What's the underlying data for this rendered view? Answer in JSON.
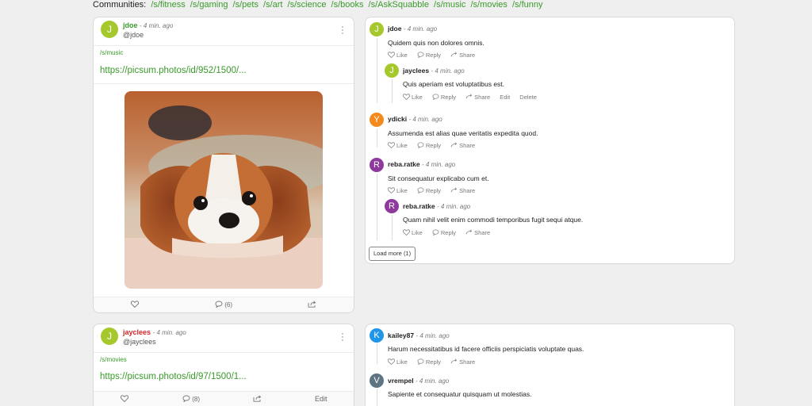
{
  "communities": {
    "label": "Communities:",
    "links": [
      "/s/fitness",
      "/s/gaming",
      "/s/pets",
      "/s/art",
      "/s/science",
      "/s/books",
      "/s/AskSquabble",
      "/s/music",
      "/s/movies",
      "/s/funny"
    ]
  },
  "colors": {
    "accent": "#3a9a2b",
    "avatar_lime": "#a5c92d",
    "avatar_orange": "#f28a1d",
    "avatar_purple": "#8e3a9d",
    "avatar_blue": "#2196e8",
    "avatar_slate": "#5d7482"
  },
  "posts": [
    {
      "avatar_letter": "J",
      "author": "jdoe",
      "time": "- 4 min. ago",
      "handle": "@jdoe",
      "community": "/s/music",
      "link": "https://picsum.photos/id/952/1500/...",
      "comment_count": "(6)",
      "image": "photo of a cavalier king charles spaniel puppy resting on a bed"
    },
    {
      "avatar_letter": "J",
      "author": "jayclees",
      "time": "- 4 min. ago",
      "handle": "@jayclees",
      "community": "/s/movies",
      "link": "https://picsum.photos/id/97/1500/1...",
      "comment_count": "(8)",
      "edit_label": "Edit"
    }
  ],
  "comment_actions": {
    "like": "Like",
    "reply": "Reply",
    "share": "Share",
    "edit": "Edit",
    "delete": "Delete"
  },
  "thread1": {
    "comments": [
      {
        "letter": "J",
        "name": "jdoe",
        "time": "- 4 min. ago",
        "text": "Quidem quis non dolores omnis."
      },
      {
        "letter": "J",
        "name": "jayclees",
        "time": "- 4 min. ago",
        "text": "Quis aperiam est voluptatibus est."
      },
      {
        "letter": "Y",
        "name": "ydicki",
        "time": "- 4 min. ago",
        "text": "Assumenda est alias quae veritatis expedita quod."
      },
      {
        "letter": "R",
        "name": "reba.ratke",
        "time": "- 4 min. ago",
        "text": "Sit consequatur explicabo cum et."
      },
      {
        "letter": "R",
        "name": "reba.ratke",
        "time": "- 4 min. ago",
        "text": "Quam nihil velit enim commodi temporibus fugit sequi atque."
      }
    ],
    "load_more": "Load more (1)"
  },
  "thread2": {
    "comments": [
      {
        "letter": "K",
        "name": "kailey87",
        "time": "- 4 min. ago",
        "text": "Harum necessitatibus id facere officiis perspiciatis voluptate quas."
      },
      {
        "letter": "V",
        "name": "vrempel",
        "time": "- 4 min. ago",
        "text": "Sapiente et consequatur quisquam ut molestias."
      }
    ]
  }
}
